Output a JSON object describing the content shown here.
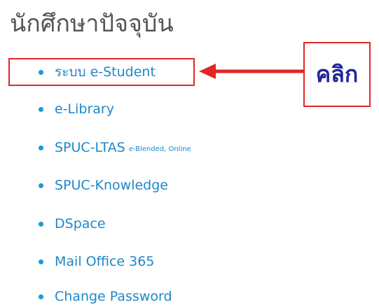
{
  "heading": "นักศึกษาปัจจุบัน",
  "links": [
    {
      "label": "ระบบ e-Student",
      "sub": ""
    },
    {
      "label": "e-Library",
      "sub": ""
    },
    {
      "label": "SPUC-LTAS",
      "sub": "e-Blended, Online"
    },
    {
      "label": "SPUC-Knowledge",
      "sub": ""
    },
    {
      "label": "DSpace",
      "sub": ""
    },
    {
      "label": "Mail Office 365",
      "sub": ""
    },
    {
      "label": "Change Password",
      "sub": ""
    }
  ],
  "annotation": {
    "label": "คลิก",
    "color": "#e32626"
  },
  "colors": {
    "link": "#1e88c8",
    "bullet": "#1a9ad6",
    "heading": "#555555",
    "annotation_text": "#22269a"
  }
}
